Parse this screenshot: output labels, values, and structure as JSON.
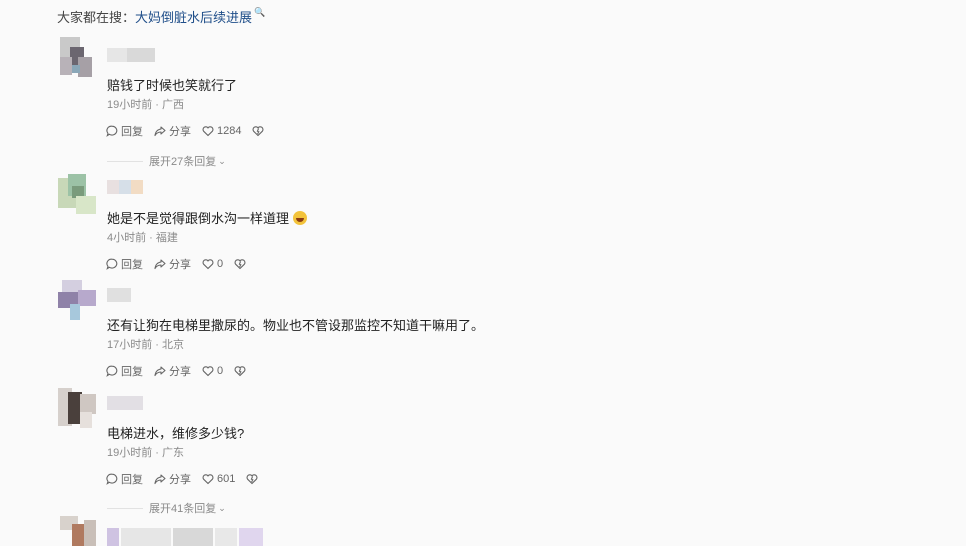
{
  "search": {
    "prefix": "大家都在搜：",
    "keyword": "大妈倒脏水后续进展"
  },
  "actions": {
    "reply": "回复",
    "share": "分享"
  },
  "comments": [
    {
      "text": "赔钱了时候也笑就行了",
      "time": "19小时前",
      "location": "广西",
      "likes": "1284",
      "expand": "展开27条回复"
    },
    {
      "text": "她是不是觉得跟倒水沟一样道理",
      "time": "4小时前",
      "location": "福建",
      "likes": "0"
    },
    {
      "text": "还有让狗在电梯里撒尿的。物业也不管设那监控不知道干嘛用了。",
      "time": "17小时前",
      "location": "北京",
      "likes": "0"
    },
    {
      "text": "电梯进水，维修多少钱?",
      "time": "19小时前",
      "location": "广东",
      "likes": "601",
      "expand": "展开41条回复"
    }
  ],
  "colors": {
    "keyword": "#1f4e89",
    "meta": "#8a8a8a",
    "text": "#222222"
  },
  "icons": [
    "search-icon",
    "reply-icon",
    "share-icon",
    "like-icon",
    "dislike-icon",
    "chevron-down-icon",
    "laughing-emoji-icon"
  ]
}
